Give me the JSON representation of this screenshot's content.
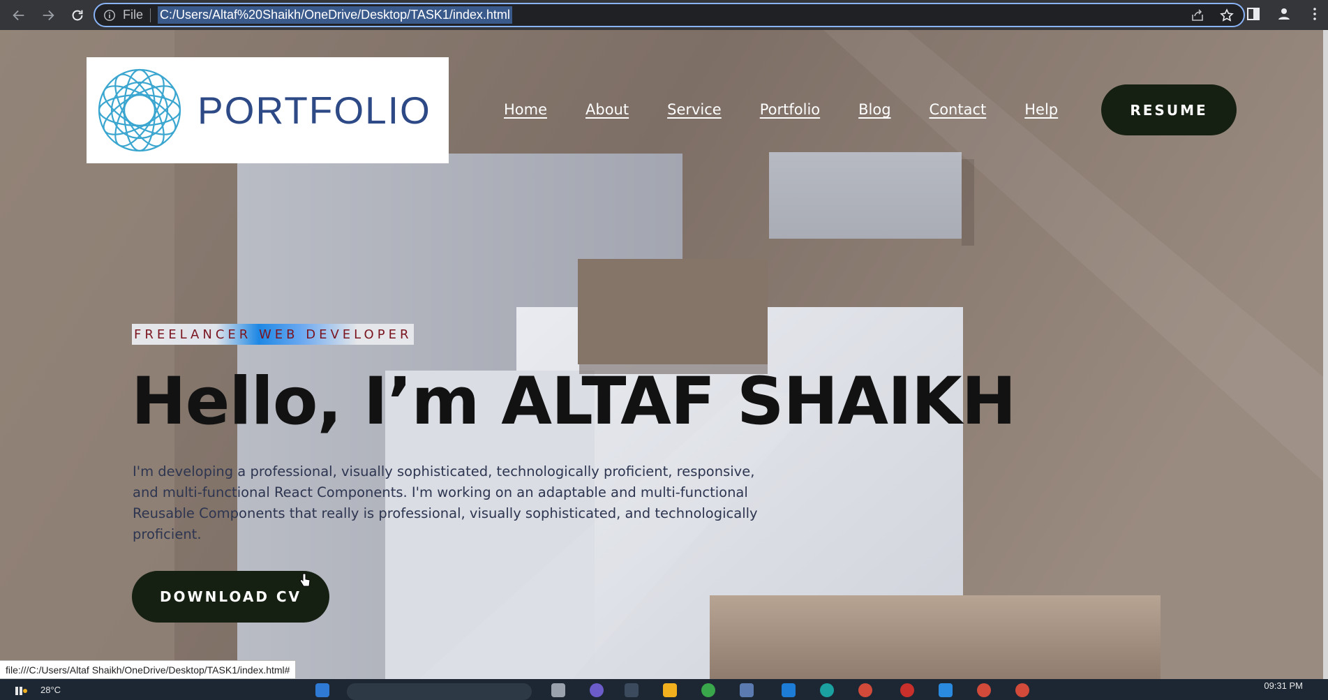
{
  "browser": {
    "scheme_label": "File",
    "url": "C:/Users/Altaf%20Shaikh/OneDrive/Desktop/TASK1/index.html",
    "status_link": "file:///C:/Users/Altaf Shaikh/OneDrive/Desktop/TASK1/index.html#"
  },
  "header": {
    "logo_text": "PORTFOLIO",
    "nav": [
      "Home",
      "About",
      "Service",
      "Portfolio",
      "Blog",
      "Contact",
      "Help"
    ],
    "resume_label": "RESUME"
  },
  "hero": {
    "tagline": "FREELANCER WEB DEVELOPER",
    "headline": "Hello, I’m ALTAF SHAIKH",
    "intro": "I'm developing a professional, visually sophisticated, technologically proficient, responsive, and multi-functional React Components. I'm working on an adaptable and multi-functional Reusable Components that really is professional, visually sophisticated, and technologically proficient.",
    "download_label": "DOWNLOAD CV"
  },
  "taskbar": {
    "temperature": "28°C",
    "time": "09:31 PM"
  },
  "colors": {
    "button_bg": "#152012",
    "logo_text": "#2e4a86",
    "logo_mark": "#3aa6d0",
    "omnibox_border": "#8ab4f8",
    "tagline_text": "#7a1520"
  }
}
